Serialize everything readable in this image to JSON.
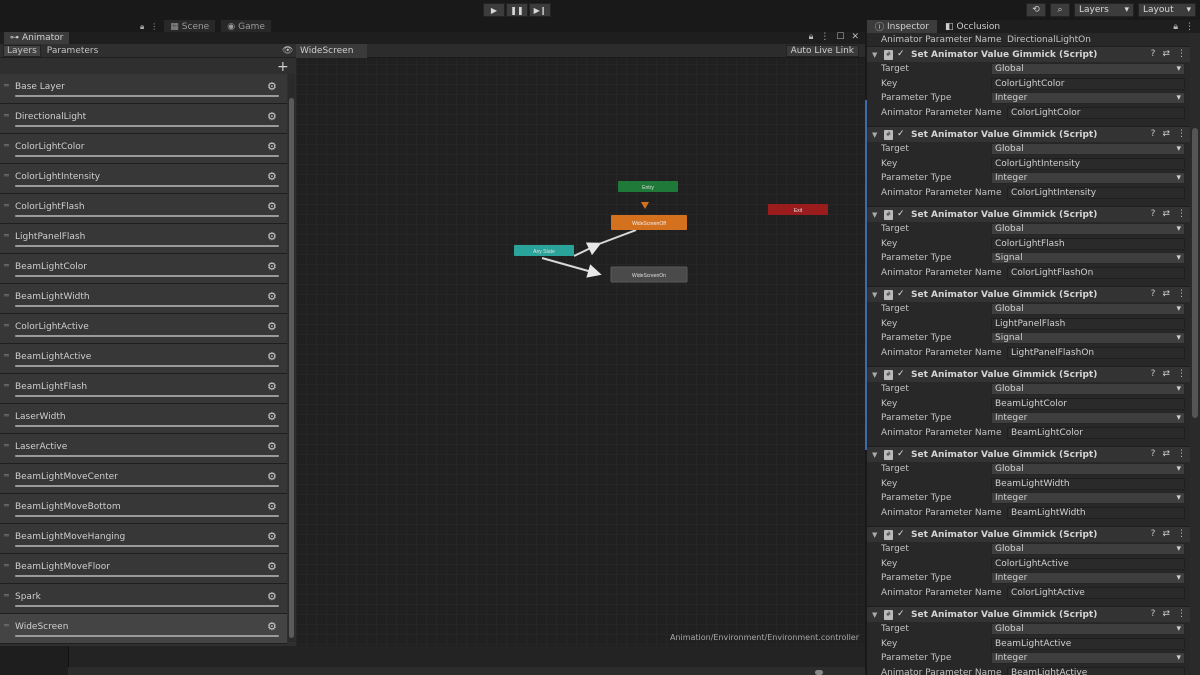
{
  "toolbar": {
    "history_icon": "history-icon",
    "search_icon": "search-icon",
    "layers_label": "Layers",
    "layout_label": "Layout"
  },
  "scene_tabs": [
    {
      "label": "Scene",
      "icon": "scene-icon"
    },
    {
      "label": "Game",
      "icon": "game-icon"
    }
  ],
  "animator": {
    "window_title": "Animator",
    "left_tabs": [
      "Layers",
      "Parameters"
    ],
    "breadcrumb": "WideScreen",
    "auto_live_link": "Auto Live Link",
    "controller_path": "Animation/Environment/Environment.controller",
    "layers": [
      {
        "name": "Base Layer"
      },
      {
        "name": "DirectionalLight"
      },
      {
        "name": "ColorLightColor"
      },
      {
        "name": "ColorLightIntensity"
      },
      {
        "name": "ColorLightFlash"
      },
      {
        "name": "LightPanelFlash"
      },
      {
        "name": "BeamLightColor"
      },
      {
        "name": "BeamLightWidth"
      },
      {
        "name": "ColorLightActive"
      },
      {
        "name": "BeamLightActive"
      },
      {
        "name": "BeamLightFlash"
      },
      {
        "name": "LaserWidth"
      },
      {
        "name": "LaserActive"
      },
      {
        "name": "BeamLightMoveCenter"
      },
      {
        "name": "BeamLightMoveBottom"
      },
      {
        "name": "BeamLightMoveHanging"
      },
      {
        "name": "BeamLightMoveFloor"
      },
      {
        "name": "Spark"
      },
      {
        "name": "WideScreen",
        "selected": true
      }
    ],
    "states": {
      "entry": "Entry",
      "exit": "Exit",
      "any_state": "Any State",
      "default_state": "WideScreenOff",
      "other_state": "WideScreenOn"
    },
    "state_colors": {
      "entry": "#1f7a3a",
      "exit": "#9b1c1c",
      "any_state": "#2aa39a",
      "default_state": "#d3711f",
      "other_state": "#4a4a4a"
    }
  },
  "inspector": {
    "tabs": [
      "Inspector",
      "Occlusion"
    ],
    "cut_row": {
      "label": "Animator Parameter Name",
      "value": "DirectionalLightOn"
    },
    "component_title": "Set Animator Value Gimmick (Script)",
    "labels": {
      "target": "Target",
      "key": "Key",
      "parameter_type": "Parameter Type",
      "animator_parameter_name": "Animator Parameter Name"
    },
    "components": [
      {
        "target": "Global",
        "key": "ColorLightColor",
        "type": "Integer",
        "param": "ColorLightColor"
      },
      {
        "target": "Global",
        "key": "ColorLightIntensity",
        "type": "Integer",
        "param": "ColorLightIntensity"
      },
      {
        "target": "Global",
        "key": "ColorLightFlash",
        "type": "Signal",
        "param": "ColorLightFlashOn"
      },
      {
        "target": "Global",
        "key": "LightPanelFlash",
        "type": "Signal",
        "param": "LightPanelFlashOn"
      },
      {
        "target": "Global",
        "key": "BeamLightColor",
        "type": "Integer",
        "param": "BeamLightColor"
      },
      {
        "target": "Global",
        "key": "BeamLightWidth",
        "type": "Integer",
        "param": "BeamLightWidth"
      },
      {
        "target": "Global",
        "key": "ColorLightActive",
        "type": "Integer",
        "param": "ColorLightActive"
      },
      {
        "target": "Global",
        "key": "BeamLightActive",
        "type": "Integer",
        "param": "BeamLightActive"
      }
    ]
  }
}
